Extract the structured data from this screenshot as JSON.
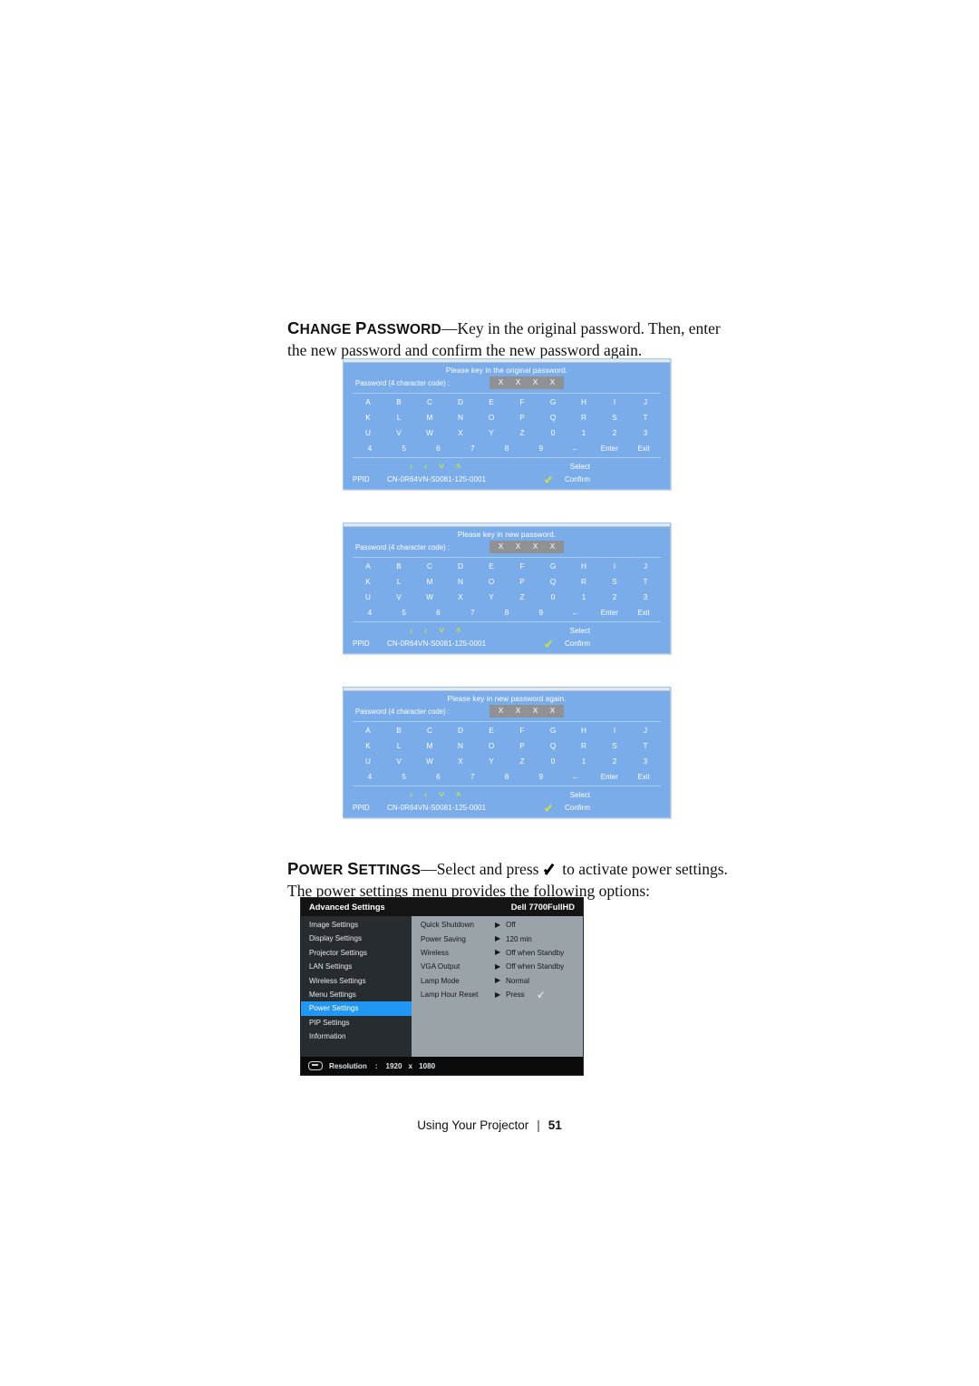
{
  "page": {
    "footer_label": "Using Your Projector",
    "footer_separator": "|",
    "page_number": "51"
  },
  "paragraphs": {
    "change_password": {
      "term_cap": "C",
      "term_rest": "HANGE ",
      "term_cap2": "P",
      "term_rest2": "ASSWORD",
      "dash": "—",
      "body": "Key in the original password. Then, enter the new password and confirm the new password again."
    },
    "power_settings": {
      "term_cap": "P",
      "term_rest": "OWER ",
      "term_cap2": "S",
      "term_rest2": "ETTINGS",
      "dash": "—",
      "body_before": "Select and press ",
      "body_after": " to activate power settings. The power settings menu provides the following options:"
    }
  },
  "password_dialogs": [
    {
      "title": "Please key in the original password.",
      "field_label": "Password (4 character code) :",
      "chars": [
        "X",
        "X",
        "X",
        "X"
      ],
      "keys": [
        [
          "A",
          "B",
          "C",
          "D",
          "E",
          "F",
          "G",
          "H",
          "I",
          "J"
        ],
        [
          "K",
          "L",
          "M",
          "N",
          "O",
          "P",
          "Q",
          "R",
          "S",
          "T"
        ],
        [
          "U",
          "V",
          "W",
          "X",
          "Y",
          "Z",
          "0",
          "1",
          "2",
          "3"
        ],
        [
          "4",
          "5",
          "6",
          "7",
          "8",
          "9",
          "←",
          "Enter",
          "Exit"
        ]
      ],
      "nav_arrows": [
        "›",
        "‹",
        "˅",
        "˄"
      ],
      "select_label": "Select",
      "ppid_label": "PPID",
      "ppid_value": "CN-0R64VN-S0081-125-0001",
      "confirm_label": "Confirm"
    },
    {
      "title": "Please key in new password.",
      "field_label": "Password (4 character code) :",
      "chars": [
        "X",
        "X",
        "X",
        "X"
      ],
      "keys": [
        [
          "A",
          "B",
          "C",
          "D",
          "E",
          "F",
          "G",
          "H",
          "I",
          "J"
        ],
        [
          "K",
          "L",
          "M",
          "N",
          "O",
          "P",
          "Q",
          "R",
          "S",
          "T"
        ],
        [
          "U",
          "V",
          "W",
          "X",
          "Y",
          "Z",
          "0",
          "1",
          "2",
          "3"
        ],
        [
          "4",
          "5",
          "6",
          "7",
          "8",
          "9",
          "←",
          "Enter",
          "Exit"
        ]
      ],
      "nav_arrows": [
        "›",
        "‹",
        "˅",
        "˄"
      ],
      "select_label": "Select",
      "ppid_label": "PPID",
      "ppid_value": "CN-0R64VN-S0081-125-0001",
      "confirm_label": "Confirm"
    },
    {
      "title": "Please key in new password again.",
      "field_label": "Password (4 character code) :",
      "chars": [
        "X",
        "X",
        "X",
        "X"
      ],
      "keys": [
        [
          "A",
          "B",
          "C",
          "D",
          "E",
          "F",
          "G",
          "H",
          "I",
          "J"
        ],
        [
          "K",
          "L",
          "M",
          "N",
          "O",
          "P",
          "Q",
          "R",
          "S",
          "T"
        ],
        [
          "U",
          "V",
          "W",
          "X",
          "Y",
          "Z",
          "0",
          "1",
          "2",
          "3"
        ],
        [
          "4",
          "5",
          "6",
          "7",
          "8",
          "9",
          "←",
          "Enter",
          "Exit"
        ]
      ],
      "nav_arrows": [
        "›",
        "‹",
        "˅",
        "˄"
      ],
      "select_label": "Select",
      "ppid_label": "PPID",
      "ppid_value": "CN-0R64VN-S0081-125-0001",
      "confirm_label": "Confirm"
    }
  ],
  "osd": {
    "title": "Advanced Settings",
    "model": "Dell 7700FullHD",
    "menu_items": [
      {
        "label": "Image Settings",
        "active": false
      },
      {
        "label": "Display Settings",
        "active": false
      },
      {
        "label": "Projector Settings",
        "active": false
      },
      {
        "label": "LAN Settings",
        "active": false
      },
      {
        "label": "Wireless Settings",
        "active": false
      },
      {
        "label": "Menu Settings",
        "active": false
      },
      {
        "label": "Power Settings",
        "active": true
      },
      {
        "label": "PIP Settings",
        "active": false
      },
      {
        "label": "Information",
        "active": false
      }
    ],
    "options": [
      {
        "name": "Quick Shutdown",
        "arrow": "▶",
        "value": "Off",
        "tick": false
      },
      {
        "name": "Power Saving",
        "arrow": "▶",
        "value": "120 min",
        "tick": false
      },
      {
        "name": "Wireless",
        "arrow": "▶",
        "value": "Off when Standby",
        "tick": false
      },
      {
        "name": "VGA Output",
        "arrow": "▶",
        "value": "Off when Standby",
        "tick": false
      },
      {
        "name": "Lamp Mode",
        "arrow": "▶",
        "value": "Normal",
        "tick": false
      },
      {
        "name": "Lamp Hour Reset",
        "arrow": "▶",
        "value": "Press",
        "tick": true
      }
    ],
    "status": {
      "resolution_label": "Resolution",
      "separator": ":",
      "width": "1920",
      "times": "x",
      "height": "1080"
    },
    "colors": {
      "highlight": "#2196f3",
      "panel": "#9aa3a8",
      "sidebar": "#272c31"
    }
  }
}
